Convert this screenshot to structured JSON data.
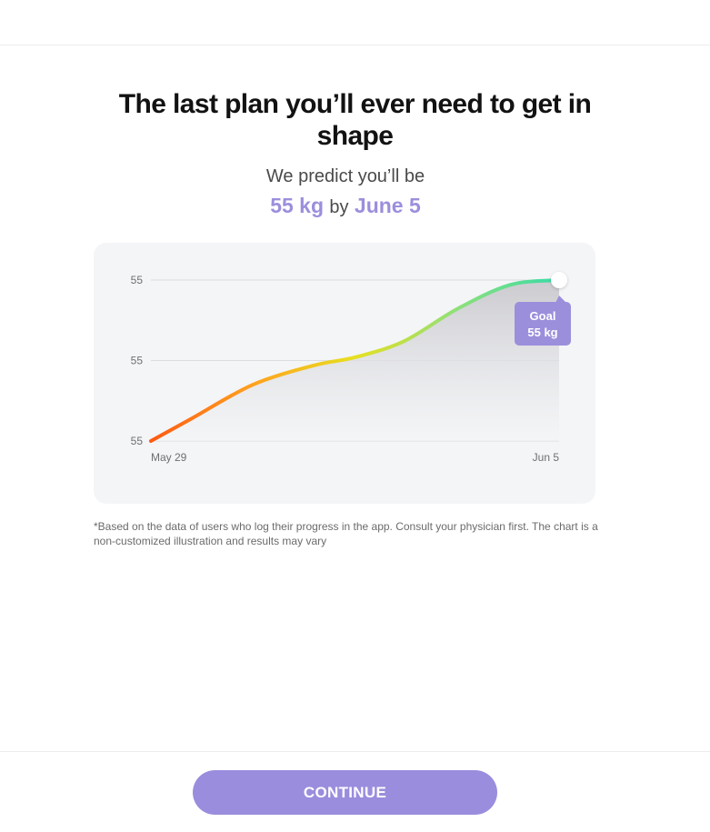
{
  "headline": "The last plan you’ll ever need to get in shape",
  "prediction": {
    "intro": "We predict you’ll be",
    "weight": "55 kg",
    "connector": "by",
    "date": "June 5"
  },
  "chart_data": {
    "type": "area",
    "x_start_label": "May 29",
    "x_end_label": "Jun 5",
    "y_tick_labels": [
      "55",
      "55",
      "55"
    ],
    "series": [
      {
        "x": [
          0,
          0.1,
          0.25,
          0.4,
          0.5,
          0.62,
          0.75,
          0.88,
          1.0
        ],
        "values": [
          0,
          0.14,
          0.35,
          0.47,
          0.52,
          0.62,
          0.82,
          0.97,
          1.0
        ]
      }
    ],
    "goal_label": "Goal",
    "goal_value": "55 kg",
    "gradient_colors": [
      "#ff5a12",
      "#ffa21f",
      "#e6e020",
      "#8ee07a",
      "#37dba7"
    ],
    "accent_color": "#9b8fdc",
    "grid": true
  },
  "disclaimer": "*Based on the data of users who log their progress in the app. Consult your physician first. The chart is a non-customized illustration and results may vary",
  "continue_label": "CONTINUE"
}
